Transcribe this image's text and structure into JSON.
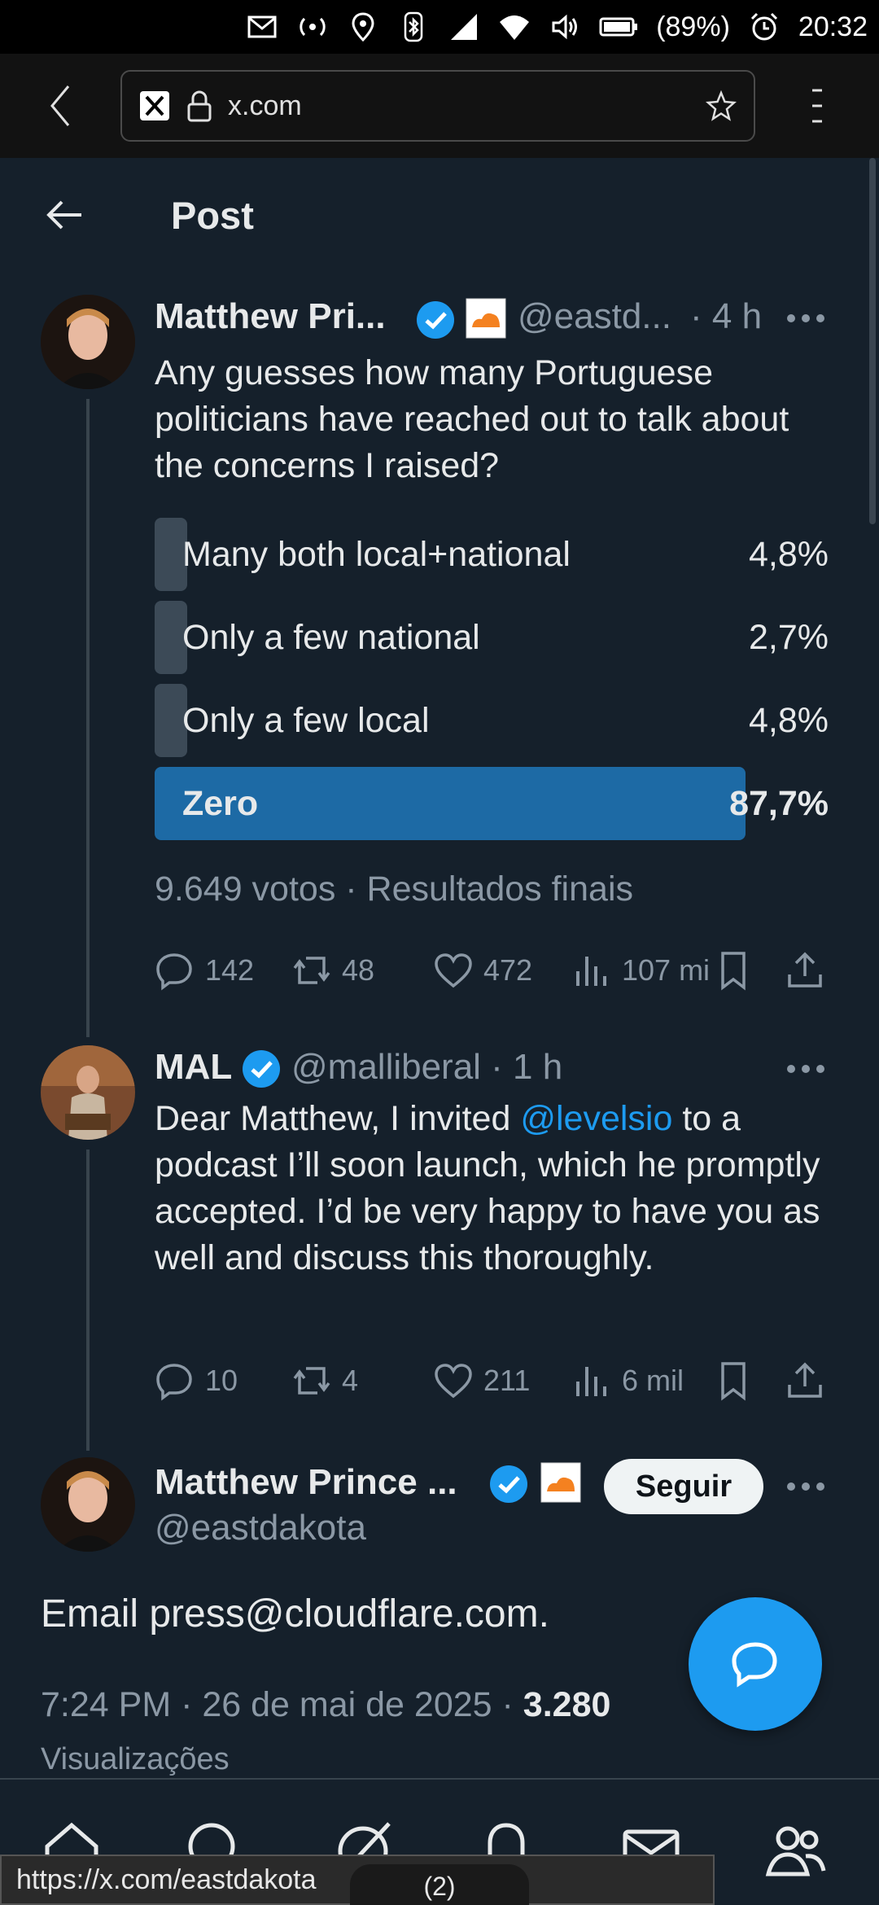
{
  "status_bar": {
    "battery": "(89%)",
    "time": "20:32",
    "icons": [
      "mail-icon",
      "hotspot-icon",
      "location-icon",
      "bluetooth-icon",
      "signal-icon",
      "wifi-icon",
      "volume-icon",
      "battery-icon",
      "alarm-icon"
    ]
  },
  "browser": {
    "url": "x.com"
  },
  "header": {
    "title": "Post"
  },
  "tweet1": {
    "name": "Matthew Pri...",
    "handle": "@eastd...",
    "time": "· 4 h",
    "text": "Any guesses how many Portuguese politicians have reached out to talk about the concerns I raised?",
    "poll": [
      {
        "label": "Many both local+national",
        "pct": "4,8%",
        "value": 4.8,
        "winner": false
      },
      {
        "label": "Only a few national",
        "pct": "2,7%",
        "value": 2.7,
        "winner": false
      },
      {
        "label": "Only a few local",
        "pct": "4,8%",
        "value": 4.8,
        "winner": false
      },
      {
        "label": "Zero",
        "pct": "87,7%",
        "value": 87.7,
        "winner": true
      }
    ],
    "votes": "9.649 votos · Resultados finais",
    "replies": "142",
    "reposts": "48",
    "likes": "472",
    "views": "107 mi"
  },
  "tweet2": {
    "name": "MAL",
    "handle": "@malliberal · 1 h",
    "text_before": "Dear Matthew, I invited ",
    "mention": "@levelsio",
    "text_after": " to a podcast I’ll soon launch, which he promptly accepted. I’d be very happy to have you as well and discuss this thoroughly.",
    "replies": "10",
    "reposts": "4",
    "likes": "211",
    "views": "6 mil"
  },
  "tweet3": {
    "name": "Matthew Prince ...",
    "handle": "@eastdakota",
    "follow": "Seguir",
    "text": "Email press@cloudflare.com.",
    "timestamp": "7:24 PM · 26 de mai de 2025 · ",
    "views_count": "3.280",
    "views_label": "Visualizações"
  },
  "hover_url": "https://x.com/eastdakota",
  "tab_count": "(2)",
  "colors": {
    "background": "#15202b",
    "accent": "#1d9bf0",
    "poll_winner": "#1d6aa5",
    "poll_bar": "#3c4a57",
    "muted": "#8b98a5"
  }
}
